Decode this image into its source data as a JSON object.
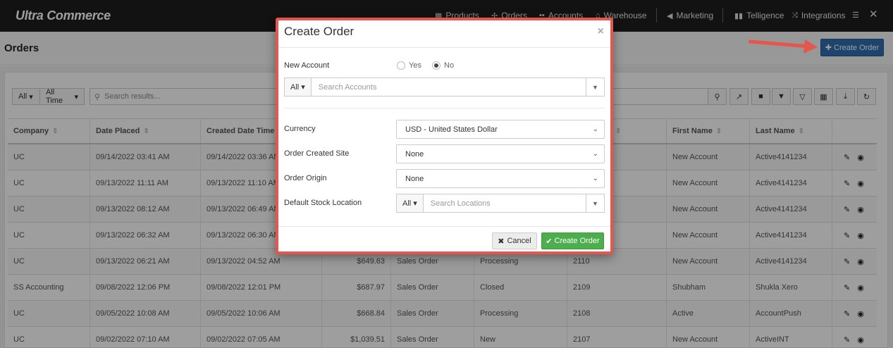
{
  "app": {
    "logo": "Ultra Commerce"
  },
  "nav": {
    "items": [
      {
        "label": "Products",
        "icon": "products-icon"
      },
      {
        "label": "Orders",
        "icon": "orders-icon"
      },
      {
        "label": "Accounts",
        "icon": "accounts-icon"
      },
      {
        "label": "Warehouse",
        "icon": "warehouse-icon"
      },
      {
        "label": "Marketing",
        "icon": "megaphone-icon"
      },
      {
        "label": "Telligence",
        "icon": "chart-icon"
      },
      {
        "label": "Integrations",
        "icon": "shuffle-icon"
      }
    ]
  },
  "page": {
    "title": "Orders",
    "create_button": "Create Order"
  },
  "filters": {
    "all": "All",
    "time": "All Time",
    "search_placeholder": "Search results..."
  },
  "table": {
    "columns": [
      "Company",
      "Date Placed",
      "Created Date Time",
      "",
      "",
      "",
      "",
      "First Name",
      "Last Name",
      ""
    ],
    "rows": [
      {
        "company": "UC",
        "date_placed": "09/14/2022 03:41 AM",
        "created": "09/14/2022 03:36 AM",
        "total": "",
        "type": "",
        "status": "",
        "number": "",
        "first": "New Account",
        "last": "Active4141234"
      },
      {
        "company": "UC",
        "date_placed": "09/13/2022 11:11 AM",
        "created": "09/13/2022 11:10 AM",
        "total": "",
        "type": "",
        "status": "",
        "number": "",
        "first": "New Account",
        "last": "Active4141234"
      },
      {
        "company": "UC",
        "date_placed": "09/13/2022 08:12 AM",
        "created": "09/13/2022 06:49 AM",
        "total": "",
        "type": "",
        "status": "",
        "number": "",
        "first": "New Account",
        "last": "Active4141234"
      },
      {
        "company": "UC",
        "date_placed": "09/13/2022 06:32 AM",
        "created": "09/13/2022 06:30 AM",
        "total": "",
        "type": "",
        "status": "",
        "number": "",
        "first": "New Account",
        "last": "Active4141234"
      },
      {
        "company": "UC",
        "date_placed": "09/13/2022 06:21 AM",
        "created": "09/13/2022 04:52 AM",
        "total": "$649.63",
        "type": "Sales Order",
        "status": "Processing",
        "number": "2110",
        "first": "New Account",
        "last": "Active4141234"
      },
      {
        "company": "SS Accounting",
        "date_placed": "09/08/2022 12:06 PM",
        "created": "09/08/2022 12:01 PM",
        "total": "$687.97",
        "type": "Sales Order",
        "status": "Closed",
        "number": "2109",
        "first": "Shubham",
        "last": "Shukla Xero"
      },
      {
        "company": "UC",
        "date_placed": "09/05/2022 10:08 AM",
        "created": "09/05/2022 10:06 AM",
        "total": "$668.84",
        "type": "Sales Order",
        "status": "Processing",
        "number": "2108",
        "first": "Active",
        "last": "AccountPush"
      },
      {
        "company": "UC",
        "date_placed": "09/02/2022 07:10 AM",
        "created": "09/02/2022 07:05 AM",
        "total": "$1,039.51",
        "type": "Sales Order",
        "status": "New",
        "number": "2107",
        "first": "New Account",
        "last": "ActiveINT"
      }
    ]
  },
  "modal": {
    "title": "Create Order",
    "new_account_label": "New Account",
    "yes_label": "Yes",
    "no_label": "No",
    "new_account_selected": "No",
    "account_filter": "All",
    "account_placeholder": "Search Accounts",
    "currency_label": "Currency",
    "currency_value": "USD - United States Dollar",
    "site_label": "Order Created Site",
    "site_value": "None",
    "origin_label": "Order Origin",
    "origin_value": "None",
    "stock_label": "Default Stock Location",
    "stock_filter": "All",
    "stock_placeholder": "Search Locations",
    "cancel_label": "Cancel",
    "submit_label": "Create Order"
  },
  "colors": {
    "accent": "#2f6fae",
    "success": "#4cae4c",
    "highlight": "#e5564d"
  }
}
